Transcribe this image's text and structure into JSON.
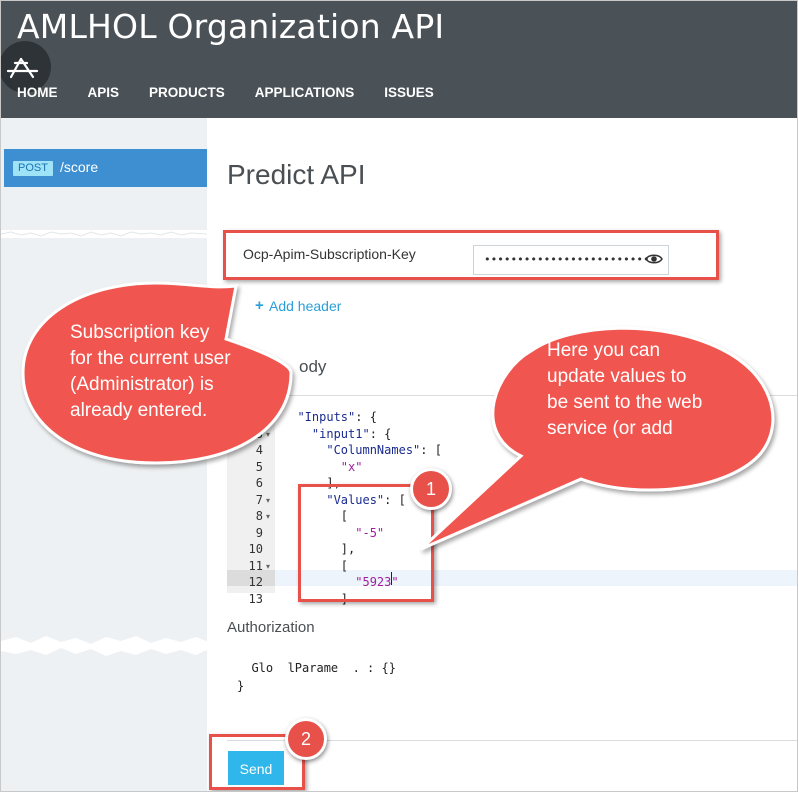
{
  "app": {
    "title": "AMLHOL Organization API"
  },
  "nav": {
    "items": [
      "HOME",
      "APIS",
      "PRODUCTS",
      "APPLICATIONS",
      "ISSUES"
    ]
  },
  "sidebar": {
    "operation": {
      "method": "POST",
      "path": "/score"
    }
  },
  "main": {
    "title": "Predict API",
    "header_name": "Ocp-Apim-Subscription-Key",
    "header_value_masked": "••••••••••••••••••••••••••",
    "add_header": "Add header",
    "request_body_label": "ody",
    "authorization_label": "Authorization",
    "send_label": "Send"
  },
  "code": {
    "lines": [
      {
        "n": "",
        "fold": false,
        "indent": "  ",
        "parts": [
          [
            "str-key",
            "\"Inputs\""
          ],
          [
            "pun",
            ": {"
          ]
        ]
      },
      {
        "n": "3",
        "fold": true,
        "indent": "    ",
        "parts": [
          [
            "str-key",
            "\"input1\""
          ],
          [
            "pun",
            ": {"
          ]
        ]
      },
      {
        "n": "4",
        "fold": false,
        "indent": "      ",
        "parts": [
          [
            "str-key",
            "\"ColumnNames\""
          ],
          [
            "pun",
            ": ["
          ]
        ]
      },
      {
        "n": "5",
        "fold": false,
        "indent": "        ",
        "parts": [
          [
            "str",
            "\"x\""
          ]
        ]
      },
      {
        "n": "6",
        "fold": false,
        "indent": "      ",
        "parts": [
          [
            "pun",
            "],"
          ]
        ]
      },
      {
        "n": "7",
        "fold": true,
        "indent": "      ",
        "parts": [
          [
            "str-key",
            "\"Values\""
          ],
          [
            "pun",
            ": ["
          ]
        ]
      },
      {
        "n": "8",
        "fold": true,
        "indent": "        ",
        "parts": [
          [
            "pun",
            "["
          ]
        ]
      },
      {
        "n": "9",
        "fold": false,
        "indent": "          ",
        "parts": [
          [
            "str",
            "\"-5\""
          ]
        ]
      },
      {
        "n": "10",
        "fold": false,
        "indent": "        ",
        "parts": [
          [
            "pun",
            "],"
          ]
        ]
      },
      {
        "n": "11",
        "fold": true,
        "indent": "        ",
        "parts": [
          [
            "pun",
            "["
          ]
        ]
      },
      {
        "n": "12",
        "fold": false,
        "indent": "          ",
        "parts": [
          [
            "str",
            "\"5923\""
          ]
        ]
      },
      {
        "n": "13",
        "fold": false,
        "indent": "        ",
        "parts": [
          [
            "pun",
            "]"
          ]
        ]
      }
    ],
    "params_line1": "  Glo  lParame  . : {}",
    "params_line2": "}"
  },
  "callouts": {
    "left": [
      "Subscription key",
      "for the current user",
      "(Administrator) is",
      "already entered."
    ],
    "right": [
      "Here you can",
      "update values to",
      "be sent to the web",
      "service (or add"
    ]
  },
  "steps": {
    "one": "1",
    "two": "2"
  },
  "icons": {
    "logo": "app-store-logo-icon",
    "eye": "eye-icon"
  },
  "colors": {
    "header_bg": "#4b5257",
    "accent_blue": "#3d8fd1",
    "send_button": "#2fb6ea",
    "annotation_red": "#e8514a"
  }
}
